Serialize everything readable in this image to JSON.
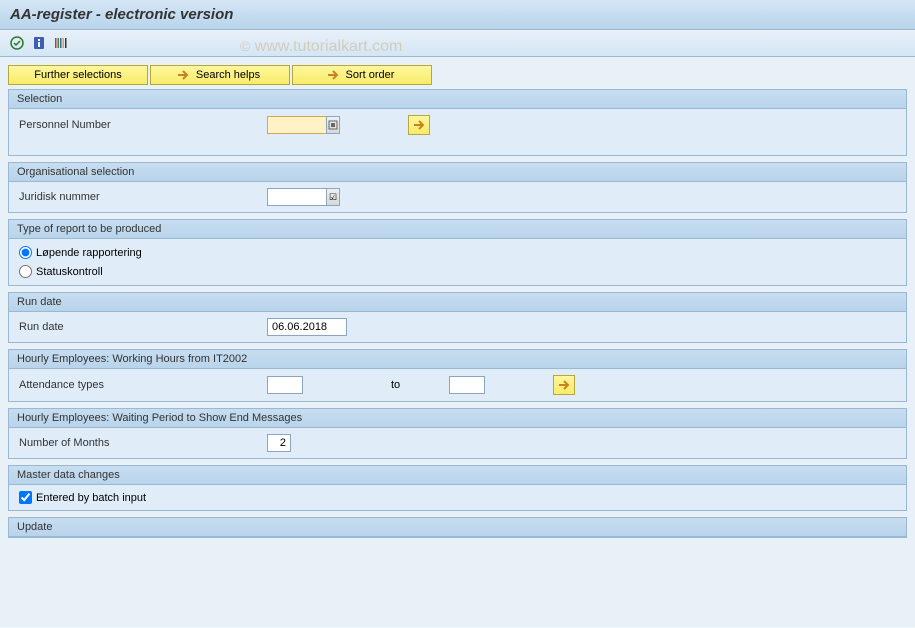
{
  "title": "AA-register - electronic version",
  "watermark": "© www.tutorialkart.com",
  "buttons": {
    "further_selections": "Further selections",
    "search_helps": "Search helps",
    "sort_order": "Sort order"
  },
  "groups": {
    "selection": {
      "title": "Selection",
      "personnel_number_label": "Personnel Number",
      "personnel_number_value": ""
    },
    "org_selection": {
      "title": "Organisational selection",
      "juridisk_label": "Juridisk nummer",
      "juridisk_value": ""
    },
    "report_type": {
      "title": "Type of report to be produced",
      "opt1": "Løpende rapportering",
      "opt2": "Statuskontroll",
      "selected": "opt1"
    },
    "run_date": {
      "title": "Run date",
      "label": "Run date",
      "value": "06.06.2018"
    },
    "hourly_hours": {
      "title": "Hourly Employees: Working Hours from IT2002",
      "att_label": "Attendance types",
      "att_from": "",
      "to_label": "to",
      "att_to": ""
    },
    "hourly_wait": {
      "title": "Hourly Employees: Waiting Period to Show End Messages",
      "months_label": "Number of Months",
      "months_value": "2"
    },
    "master_data": {
      "title": "Master data changes",
      "batch_label": "Entered by batch input",
      "batch_checked": true
    },
    "update": {
      "title": "Update"
    }
  }
}
